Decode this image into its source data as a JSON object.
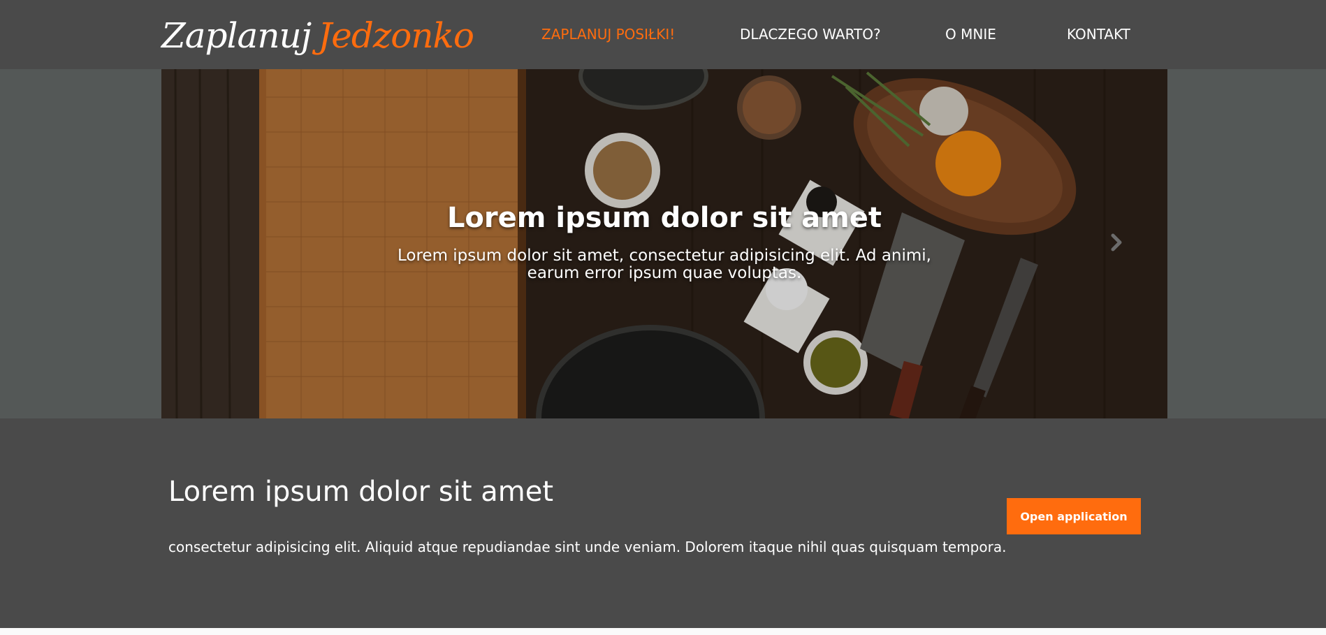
{
  "brand": {
    "part1": "Zaplanuj",
    "part2": "Jedzonko",
    "accent_color": "#ff6c0e"
  },
  "nav": {
    "items": [
      {
        "label": "ZAPLANUJ POSIŁKI!",
        "active": true
      },
      {
        "label": "DLACZEGO WARTO?",
        "active": false
      },
      {
        "label": "O MNIE",
        "active": false
      },
      {
        "label": "KONTAKT",
        "active": false
      }
    ]
  },
  "hero": {
    "title": "Lorem ipsum dolor sit amet",
    "subtitle": "Lorem ipsum dolor sit amet, consectetur adipisicing elit. Ad animi, earum error ipsum quae voluptas.",
    "next_icon": "chevron-right-icon"
  },
  "main": {
    "title": "Lorem ipsum dolor sit amet",
    "text": "consectetur adipisicing elit. Aliquid atque repudiandae sint unde veniam. Dolorem itaque nihil quas quisquam tempora.",
    "button_label": "Open application"
  },
  "colors": {
    "header_bg": "#4a4a4a",
    "hero_band_bg": "#545857",
    "content_bg": "#4a4a4a",
    "button_bg": "#ff6c0e"
  }
}
